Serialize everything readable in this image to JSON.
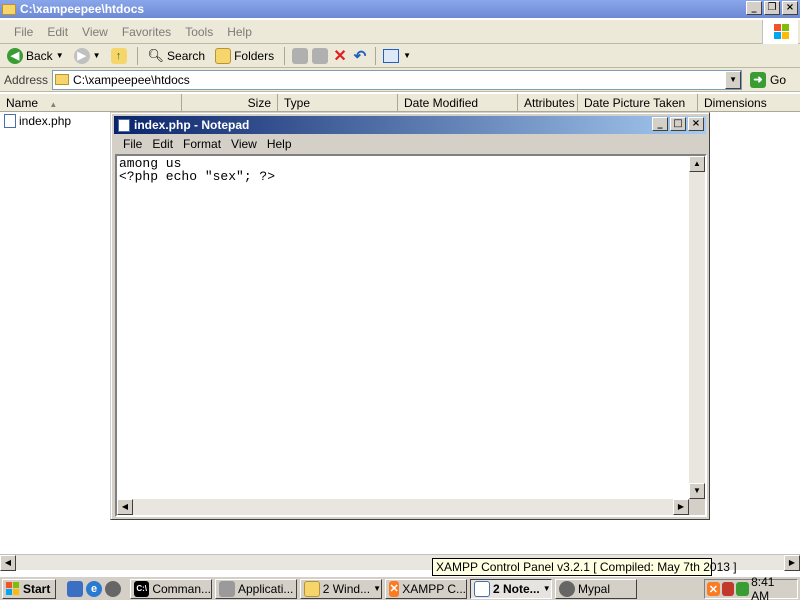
{
  "explorer": {
    "title": "C:\\xampeepee\\htdocs",
    "menu": [
      "File",
      "Edit",
      "View",
      "Favorites",
      "Tools",
      "Help"
    ],
    "toolbar": {
      "back": "Back",
      "search": "Search",
      "folders": "Folders"
    },
    "address_label": "Address",
    "address_value": "C:\\xampeepee\\htdocs",
    "go_label": "Go",
    "columns": [
      "Name",
      "Size",
      "Type",
      "Date Modified",
      "Attributes",
      "Date Picture Taken",
      "Dimensions"
    ],
    "files": [
      {
        "name": "index.php"
      }
    ]
  },
  "notepad": {
    "title": "index.php - Notepad",
    "menu": [
      "File",
      "Edit",
      "Format",
      "View",
      "Help"
    ],
    "content": "among us\n<?php echo \"sex\"; ?>"
  },
  "tooltip": "XAMPP Control Panel v3.2.1   [ Compiled: May 7th 2013 ]",
  "taskbar": {
    "start_label": "Start",
    "buttons": [
      "Comman...",
      "Applicati...",
      "2 Wind...",
      "XAMPP C...",
      "2 Note...",
      "Mypal"
    ],
    "clock": "8:41 AM"
  },
  "colors": {
    "titlebar": "#0a246a",
    "face": "#d4d0c8",
    "tooltip": "#ffffe1"
  }
}
